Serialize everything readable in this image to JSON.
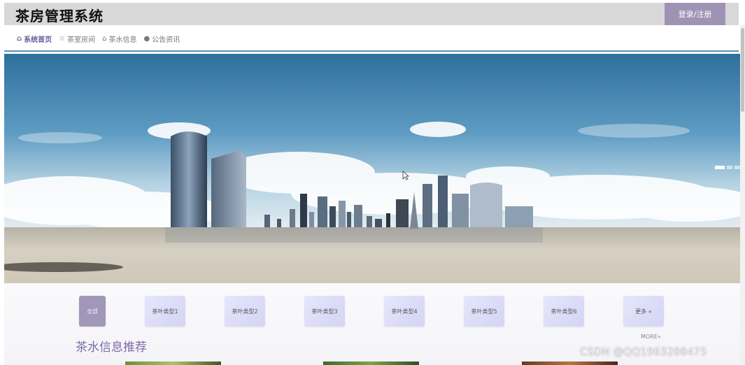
{
  "header": {
    "title": "茶房管理系统",
    "login_label": "登录/注册"
  },
  "nav": {
    "items": [
      {
        "icon": "home-icon",
        "label": "系统首页",
        "active": true
      },
      {
        "icon": "star-icon",
        "label": "茶室房间",
        "active": false
      },
      {
        "icon": "bag-icon",
        "label": "茶水信息",
        "active": false
      },
      {
        "icon": "info-icon",
        "label": "公告资讯",
        "active": false
      }
    ]
  },
  "banner": {
    "slides": 3,
    "active_slide": 1
  },
  "categories": [
    {
      "label": "全部"
    },
    {
      "label": "茶叶类型1"
    },
    {
      "label": "茶叶类型2"
    },
    {
      "label": "茶叶类型3"
    },
    {
      "label": "茶叶类型4"
    },
    {
      "label": "茶叶类型5"
    },
    {
      "label": "茶叶类型6"
    },
    {
      "label": "更多 »"
    }
  ],
  "recommend": {
    "title": "茶水信息推荐",
    "more_label": "MORE»"
  },
  "watermark": "CSDN @QQ1963288475",
  "colors": {
    "header_bg": "#d8d8d8",
    "accent": "#9f93b5",
    "title_purple": "#7d6aa8",
    "nav_line": "#5b8fb3"
  }
}
